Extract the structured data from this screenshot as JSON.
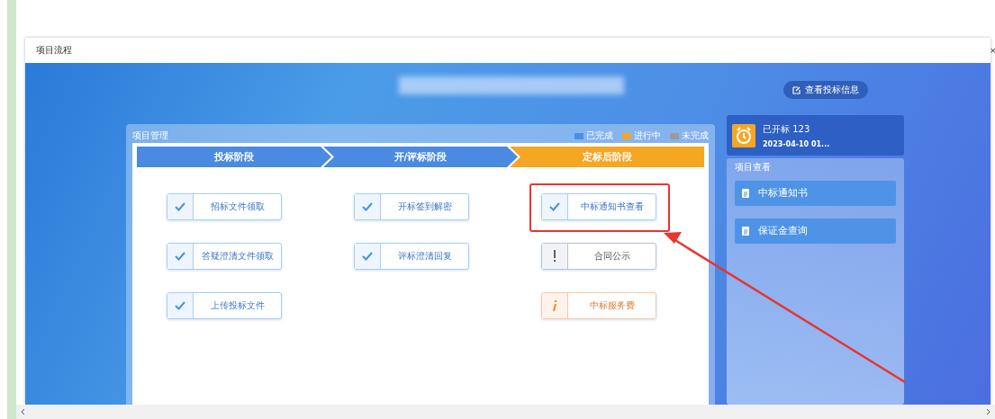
{
  "window": {
    "title": "项目流程",
    "close": "×"
  },
  "header": {
    "view_button": "查看投标信息"
  },
  "management": {
    "title": "项目管理",
    "legend": [
      {
        "label": "已完成",
        "color": "#4a90e2"
      },
      {
        "label": "进行中",
        "color": "#f5a623"
      },
      {
        "label": "未完成",
        "color": "#9b9b9b"
      }
    ],
    "stages": [
      {
        "label": "投标阶段",
        "kind": "done"
      },
      {
        "label": "开/评标阶段",
        "kind": "done"
      },
      {
        "label": "定标后阶段",
        "kind": "active"
      }
    ],
    "columns": [
      [
        {
          "label": "招标文件领取",
          "kind": "done"
        },
        {
          "label": "答疑澄清文件领取",
          "kind": "done"
        },
        {
          "label": "上传投标文件",
          "kind": "done"
        }
      ],
      [
        {
          "label": "开标签到解密",
          "kind": "done"
        },
        {
          "label": "评标澄清回复",
          "kind": "done"
        }
      ],
      [
        {
          "label": "中标通知书查看",
          "kind": "done"
        },
        {
          "label": "合同公示",
          "kind": "pending"
        },
        {
          "label": "中标服务费",
          "kind": "active"
        }
      ]
    ]
  },
  "status_card": {
    "title": "已开标 123",
    "time": "2023-04-10 01..."
  },
  "project_view": {
    "title": "项目查看",
    "items": [
      "中标通知书",
      "保证金查询"
    ]
  }
}
